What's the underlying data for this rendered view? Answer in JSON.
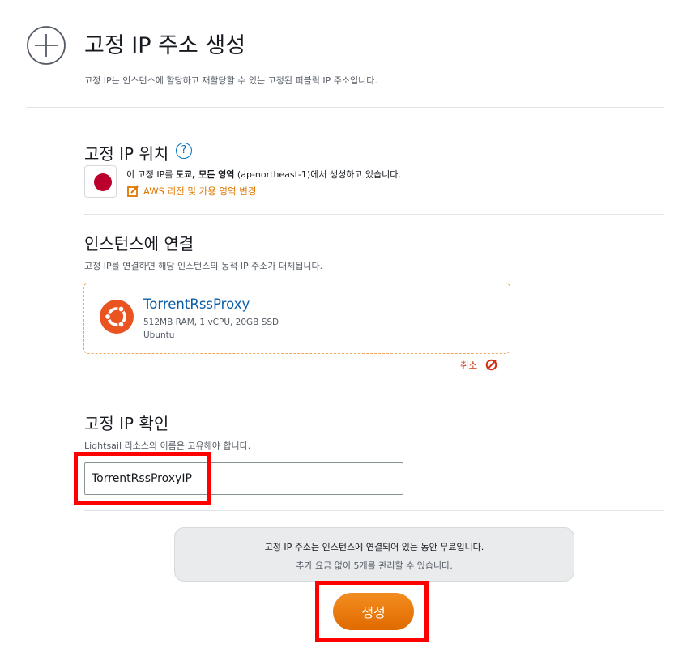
{
  "header": {
    "icon": "plus-circle-icon",
    "title": "고정 IP 주소 생성",
    "subtitle": "고정 IP는 인스턴스에 할당하고 재할당할 수 있는 고정된 퍼블릭 IP 주소입니다."
  },
  "location": {
    "title": "고정 IP 위치",
    "help_icon": "?",
    "flag_icon": "japan-flag-icon",
    "text_prefix": "이 고정 IP를 ",
    "text_region": "도쿄, 모든 영역",
    "text_suffix": " (ap-northeast-1)에서 생성하고 있습니다.",
    "change_link": "AWS 리전 및 가용 영역 변경"
  },
  "attach": {
    "title": "인스턴스에 연결",
    "description": "고정 IP를 연결하면 해당 인스턴스의 동적 IP 주소가 대체됩니다.",
    "instance": {
      "icon": "ubuntu-icon",
      "name": "TorrentRssProxy",
      "spec": "512MB RAM, 1 vCPU, 20GB SSD",
      "os": "Ubuntu"
    },
    "cancel_label": "취소"
  },
  "identify": {
    "title": "고정 IP 확인",
    "description": "Lightsail 리소스의 이름은 고유해야 합니다.",
    "input_value": "TorrentRssProxyIP"
  },
  "info": {
    "line1": "고정 IP 주소는 인스턴스에 연결되어 있는 동안 무료입니다.",
    "line2": "추가 요금 없이 5개를 관리할 수 있습니다."
  },
  "create_button": "생성",
  "colors": {
    "accent": "#e07700",
    "link_blue": "#0a5ea8",
    "highlight": "#ff0000",
    "cancel_red": "#d13212"
  }
}
